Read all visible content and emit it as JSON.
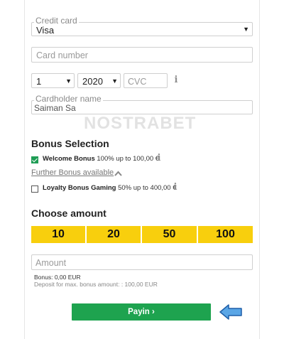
{
  "credit_card": {
    "label": "Credit card",
    "value": "Visa"
  },
  "card_number": {
    "placeholder": "Card number"
  },
  "expiry": {
    "month": "1",
    "year": "2020"
  },
  "cvc": {
    "placeholder": "CVC"
  },
  "cardholder": {
    "label": "Cardholder name",
    "value": "Saiman Sa"
  },
  "watermark": "NOSTRABET",
  "bonus": {
    "title": "Bonus Selection",
    "welcome": {
      "name": "Welcome Bonus",
      "detail": "100% up to 100,00 €",
      "checked": true
    },
    "further_link": "Further Bonus available",
    "loyalty": {
      "name": "Loyalty Bonus Gaming",
      "detail": "50% up to 400,00 €",
      "checked": false
    }
  },
  "amount": {
    "title": "Choose amount",
    "options": [
      "10",
      "20",
      "50",
      "100"
    ],
    "placeholder": "Amount",
    "bonus_note": "Bonus: 0,00 EUR",
    "deposit_note": "Deposit for max. bonus amount: : 100,00 EUR"
  },
  "payin": {
    "label": "Payin ›"
  },
  "colors": {
    "accent_yellow": "#f8cf0d",
    "payin_green": "#1ea34f",
    "arrow_blue": "#5aa6e6"
  },
  "icons": {
    "info": "info-icon",
    "caret": "chevron-down-icon",
    "chevron_up": "chevron-up-icon",
    "pointer": "arrow-left-icon"
  }
}
